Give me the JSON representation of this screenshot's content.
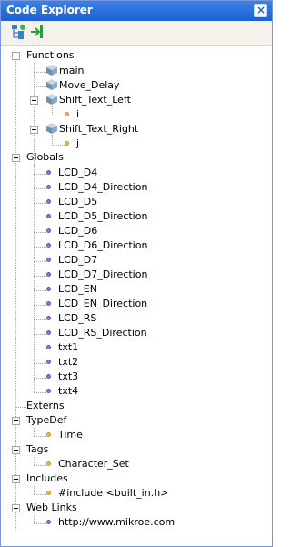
{
  "window": {
    "title": "Code Explorer"
  },
  "toolbar": {
    "buttons": [
      {
        "icon": "tree-options-icon"
      },
      {
        "icon": "export-icon"
      }
    ]
  },
  "tree": {
    "functions": {
      "label": "Functions",
      "items": [
        "main",
        "Move_Delay",
        "Shift_Text_Left",
        "i",
        "Shift_Text_Right",
        "j"
      ]
    },
    "globals": {
      "label": "Globals",
      "items": [
        "LCD_D4",
        "LCD_D4_Direction",
        "LCD_D5",
        "LCD_D5_Direction",
        "LCD_D6",
        "LCD_D6_Direction",
        "LCD_D7",
        "LCD_D7_Direction",
        "LCD_EN",
        "LCD_EN_Direction",
        "LCD_RS",
        "LCD_RS_Direction",
        "txt1",
        "txt2",
        "txt3",
        "txt4"
      ]
    },
    "externs": {
      "label": "Externs"
    },
    "typedef": {
      "label": "TypeDef",
      "items": [
        "Time"
      ]
    },
    "tags": {
      "label": "Tags",
      "items": [
        "Character_Set"
      ]
    },
    "includes": {
      "label": "Includes",
      "items": [
        "#include <built_in.h>"
      ]
    },
    "weblinks": {
      "label": "Web Links",
      "items": [
        "http://www.mikroe.com"
      ]
    }
  },
  "colors": {
    "titlebar": "#1f5fd2",
    "toolbar": "#f4f2ea",
    "global_bullet": "#9d6be6",
    "local_bullet": "#f0b64a"
  }
}
